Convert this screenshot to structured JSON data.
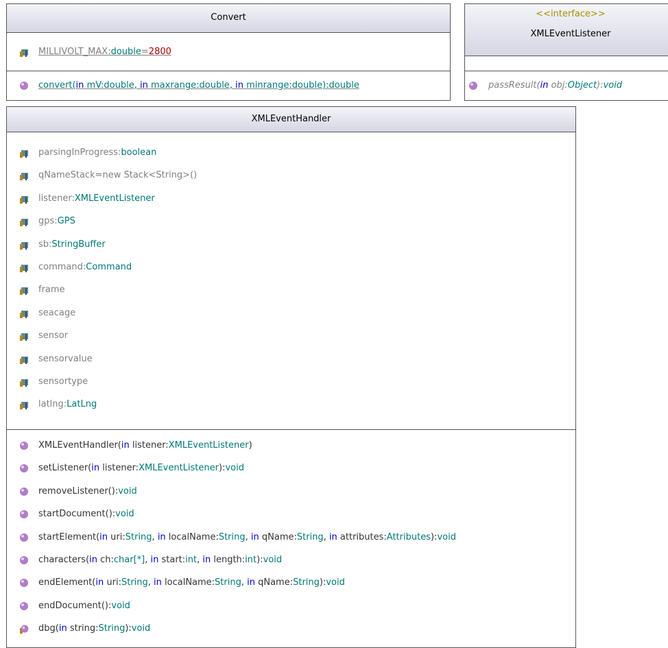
{
  "colors": {
    "keyword": "#0000c8",
    "type": "#007878",
    "plain": "#808080",
    "value": "#b00000",
    "stereotype": "#a59100",
    "header_top": "#f4f4fa",
    "header_bottom": "#d6d6e3",
    "border": "#555555"
  },
  "icons": {
    "attribute": "attribute-icon",
    "operation": "operation-icon",
    "protected_operation": "protected-operation-icon"
  },
  "convert": {
    "title": "Convert",
    "attr": {
      "name": "MILLIVOLT_MAX",
      "colon": ":",
      "type": "double",
      "eq": "=",
      "value": "2800"
    },
    "op": {
      "name": "convert(",
      "p1_dir": "in",
      "p1_name": " mV:",
      "p1_type": "double",
      "sep1": ", ",
      "p2_dir": "in",
      "p2_name": " maxrange:",
      "p2_type": "double",
      "sep2": ", ",
      "p3_dir": "in",
      "p3_name": " minrange:",
      "p3_type": "double",
      "close": "):",
      "ret": "double"
    }
  },
  "listener_iface": {
    "stereotype": "<<interface>>",
    "title": "XMLEventListener",
    "op": {
      "name": "passResult(",
      "p1_dir": "in",
      "p1_name": " obj:",
      "p1_type": "Object",
      "close": "):",
      "ret": "void"
    }
  },
  "handler": {
    "title": "XMLEventHandler",
    "attrs": [
      {
        "name": "parsingInProgress",
        "colon": ":",
        "type": "boolean"
      },
      {
        "name": "qNameStack=new Stack<String>()",
        "colon": "",
        "type": ""
      },
      {
        "name": "listener",
        "colon": ":",
        "type": "XMLEventListener"
      },
      {
        "name": "gps",
        "colon": ":",
        "type": "GPS"
      },
      {
        "name": "sb",
        "colon": ":",
        "type": "StringBuffer"
      },
      {
        "name": "command",
        "colon": ":",
        "type": "Command"
      },
      {
        "name": "frame",
        "colon": "",
        "type": ""
      },
      {
        "name": "seacage",
        "colon": "",
        "type": ""
      },
      {
        "name": "sensor",
        "colon": "",
        "type": ""
      },
      {
        "name": "sensorvalue",
        "colon": "",
        "type": ""
      },
      {
        "name": "sensortype",
        "colon": "",
        "type": ""
      },
      {
        "name": "latlng",
        "colon": ":",
        "type": "LatLng"
      }
    ],
    "ops": [
      {
        "icon": "operation-icon",
        "segs": [
          [
            "bk",
            "XMLEventHandler("
          ],
          [
            "kw",
            "in"
          ],
          [
            "bk",
            " listener:"
          ],
          [
            "ty",
            "XMLEventListener"
          ],
          [
            "bk",
            ")"
          ]
        ]
      },
      {
        "icon": "operation-icon",
        "segs": [
          [
            "bk",
            "setListener("
          ],
          [
            "kw",
            "in"
          ],
          [
            "bk",
            " listener:"
          ],
          [
            "ty",
            "XMLEventListener"
          ],
          [
            "bk",
            "):"
          ],
          [
            "ty",
            "void"
          ]
        ]
      },
      {
        "icon": "operation-icon",
        "segs": [
          [
            "bk",
            "removeListener():"
          ],
          [
            "ty",
            "void"
          ]
        ]
      },
      {
        "icon": "operation-icon",
        "segs": [
          [
            "bk",
            "startDocument():"
          ],
          [
            "ty",
            "void"
          ]
        ]
      },
      {
        "icon": "operation-icon",
        "segs": [
          [
            "bk",
            "startElement("
          ],
          [
            "kw",
            "in"
          ],
          [
            "bk",
            " uri:"
          ],
          [
            "ty",
            "String"
          ],
          [
            "bk",
            ", "
          ],
          [
            "kw",
            "in"
          ],
          [
            "bk",
            " localName:"
          ],
          [
            "ty",
            "String"
          ],
          [
            "bk",
            ", "
          ],
          [
            "kw",
            "in"
          ],
          [
            "bk",
            " qName:"
          ],
          [
            "ty",
            "String"
          ],
          [
            "bk",
            ", "
          ],
          [
            "kw",
            "in"
          ],
          [
            "bk",
            " attributes:"
          ],
          [
            "ty",
            "Attributes"
          ],
          [
            "bk",
            "):"
          ],
          [
            "ty",
            "void"
          ]
        ]
      },
      {
        "icon": "operation-icon",
        "segs": [
          [
            "bk",
            "characters("
          ],
          [
            "kw",
            "in"
          ],
          [
            "bk",
            " ch:"
          ],
          [
            "ty",
            "char[*]"
          ],
          [
            "bk",
            ", "
          ],
          [
            "kw",
            "in"
          ],
          [
            "bk",
            " start:"
          ],
          [
            "ty",
            "int"
          ],
          [
            "bk",
            ", "
          ],
          [
            "kw",
            "in"
          ],
          [
            "bk",
            " length:"
          ],
          [
            "ty",
            "int"
          ],
          [
            "bk",
            "):"
          ],
          [
            "ty",
            "void"
          ]
        ]
      },
      {
        "icon": "operation-icon",
        "segs": [
          [
            "bk",
            "endElement("
          ],
          [
            "kw",
            "in"
          ],
          [
            "bk",
            " uri:"
          ],
          [
            "ty",
            "String"
          ],
          [
            "bk",
            ", "
          ],
          [
            "kw",
            "in"
          ],
          [
            "bk",
            " localName:"
          ],
          [
            "ty",
            "String"
          ],
          [
            "bk",
            ", "
          ],
          [
            "kw",
            "in"
          ],
          [
            "bk",
            " qName:"
          ],
          [
            "ty",
            "String"
          ],
          [
            "bk",
            "):"
          ],
          [
            "ty",
            "void"
          ]
        ]
      },
      {
        "icon": "operation-icon",
        "segs": [
          [
            "bk",
            "endDocument():"
          ],
          [
            "ty",
            "void"
          ]
        ]
      },
      {
        "icon": "protected-operation-icon",
        "segs": [
          [
            "bk",
            "dbg("
          ],
          [
            "kw",
            "in"
          ],
          [
            "bk",
            " string:"
          ],
          [
            "ty",
            "String"
          ],
          [
            "bk",
            "):"
          ],
          [
            "ty",
            "void"
          ]
        ]
      }
    ]
  }
}
